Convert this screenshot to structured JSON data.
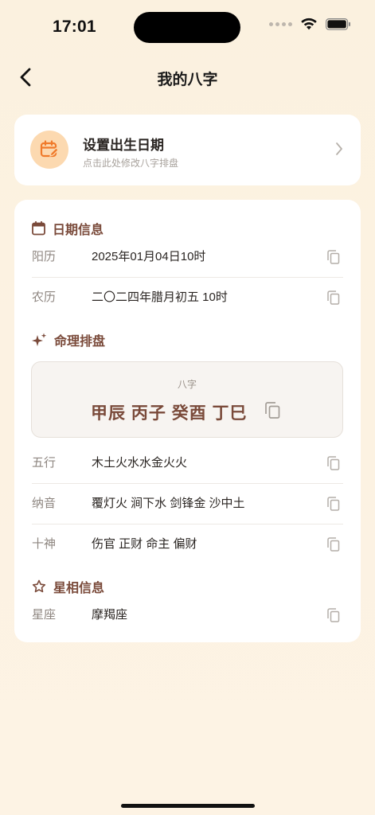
{
  "status_bar": {
    "time": "17:01"
  },
  "nav": {
    "title": "我的八字",
    "back_icon": "chevron-left-icon"
  },
  "birth_card": {
    "title": "设置出生日期",
    "subtitle": "点击此处修改八字排盘",
    "icon": "calendar-edit-icon",
    "chevron_icon": "chevron-right-icon"
  },
  "sections": {
    "date_info": {
      "title": "日期信息",
      "icon": "calendar-icon",
      "rows": [
        {
          "label": "阳历",
          "value": "2025年01月04日10时"
        },
        {
          "label": "农历",
          "value": "二〇二四年腊月初五 10时"
        }
      ]
    },
    "mingli": {
      "title": "命理排盘",
      "icon": "sparkle-icon",
      "bazi_label": "八字",
      "bazi_value": "甲辰 丙子 癸酉 丁巳",
      "rows": [
        {
          "label": "五行",
          "value": "木土火水水金火火"
        },
        {
          "label": "纳音",
          "value": "覆灯火 涧下水 剑锋金 沙中土"
        },
        {
          "label": "十神",
          "value": "伤官 正财 命主 偏财"
        }
      ]
    },
    "star_info": {
      "title": "星相信息",
      "icon": "star-outline-icon",
      "rows": [
        {
          "label": "星座",
          "value": "摩羯座"
        }
      ]
    }
  },
  "colors": {
    "background": "#fcf2e2",
    "accent_orange": "#f07a2a",
    "accent_brown": "#7a4a3a",
    "card": "#ffffff"
  }
}
